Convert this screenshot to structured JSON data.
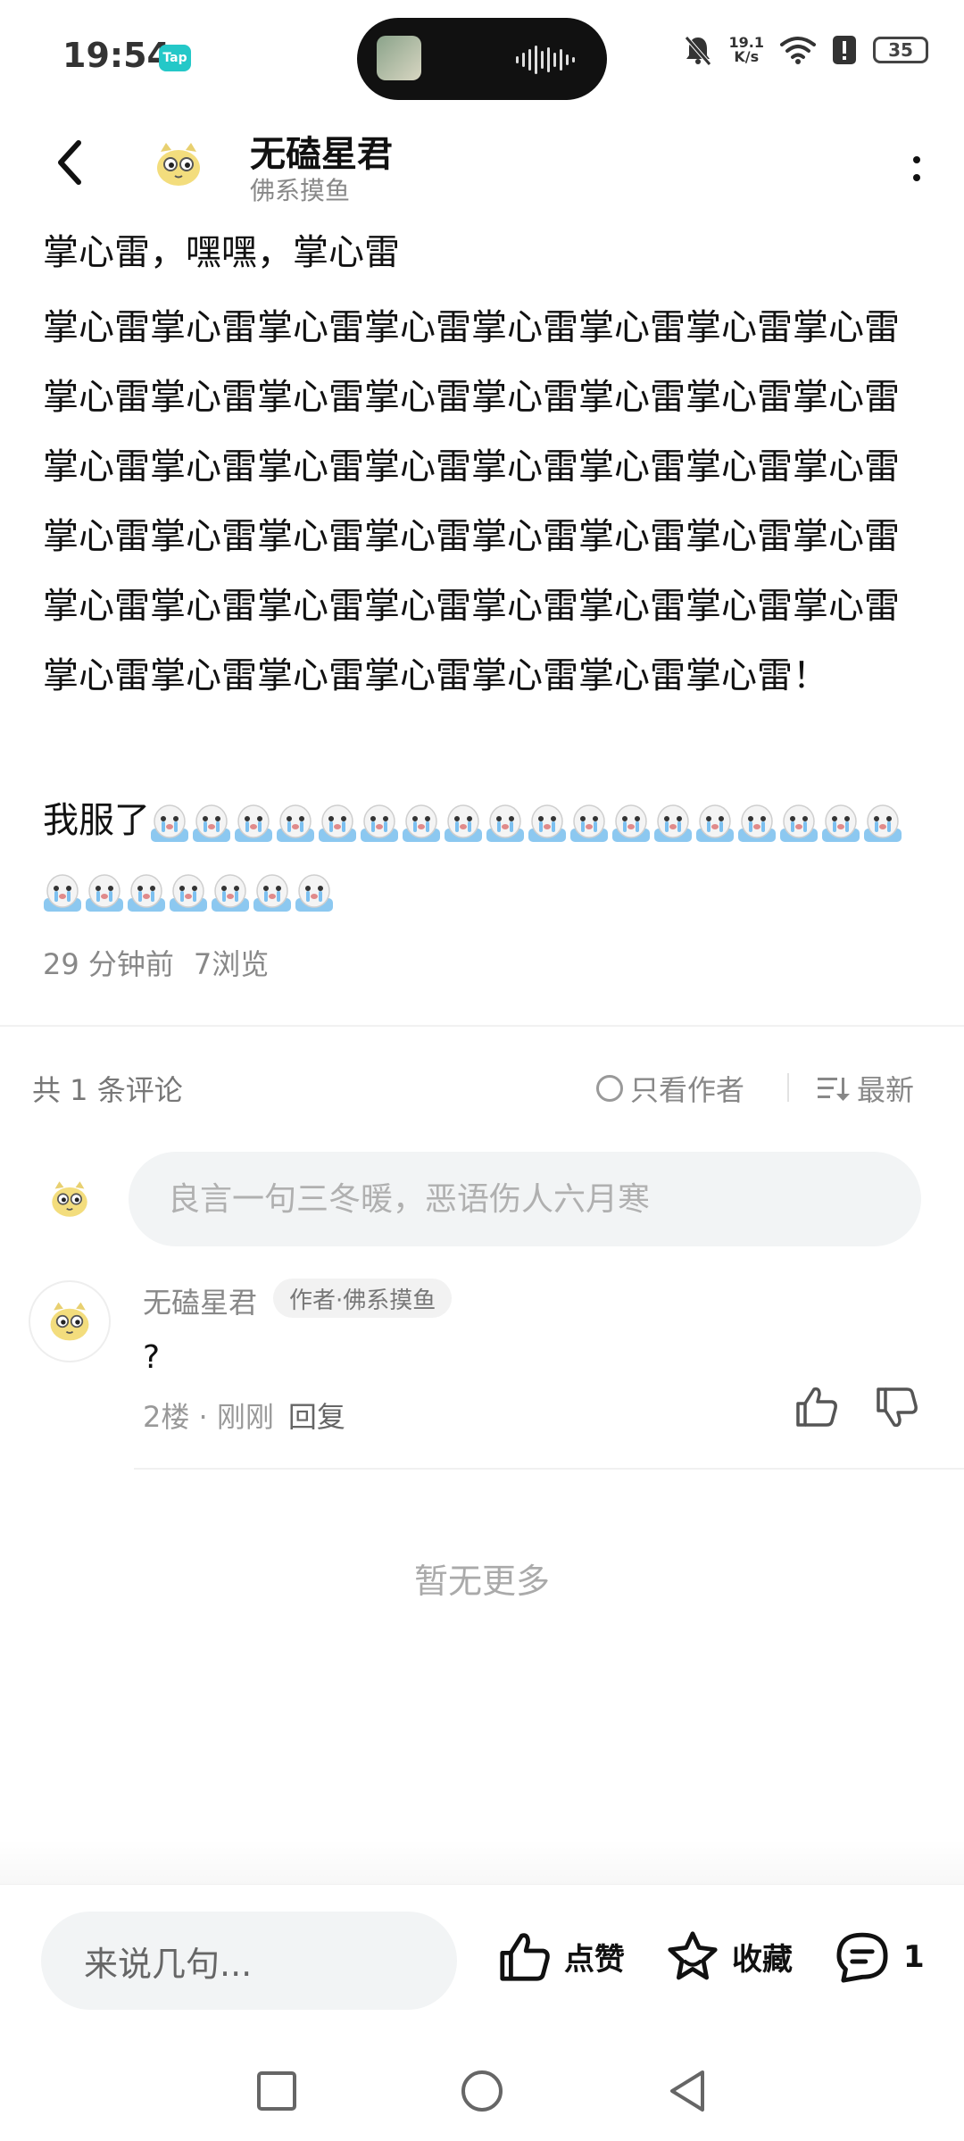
{
  "status_bar": {
    "time": "19:54",
    "app_badge": "Tap",
    "net_speed_value": "19.1",
    "net_speed_unit": "K/s",
    "battery": "35"
  },
  "header": {
    "author_name": "无磕星君",
    "author_group": "佛系摸鱼"
  },
  "post": {
    "title": "掌心雷，嘿嘿，掌心雷",
    "body": "掌心雷掌心雷掌心雷掌心雷掌心雷掌心雷掌心雷掌心雷掌心雷掌心雷掌心雷掌心雷掌心雷掌心雷掌心雷掌心雷掌心雷掌心雷掌心雷掌心雷掌心雷掌心雷掌心雷掌心雷掌心雷掌心雷掌心雷掌心雷掌心雷掌心雷掌心雷掌心雷掌心雷掌心雷掌心雷掌心雷掌心雷掌心雷掌心雷掌心雷掌心雷掌心雷掌心雷掌心雷掌心雷掌心雷掌心雷！",
    "closing_text": "我服了",
    "emoji_name": "crying-seal-emoji",
    "emoji_count": 25,
    "time_ago": "29 分钟前",
    "views": "7浏览"
  },
  "comments_bar": {
    "count_label": "共 1 条评论",
    "only_author_label": "只看作者",
    "sort_label": "最新"
  },
  "comment_input": {
    "placeholder": "良言一句三冬暖，恶语伤人六月寒"
  },
  "comments": [
    {
      "author": "无磕星君",
      "badge": "作者·佛系摸鱼",
      "text": "?",
      "floor": "2楼",
      "time": "刚刚",
      "reply_label": "回复"
    }
  ],
  "no_more_label": "暂无更多",
  "bottom_bar": {
    "input_placeholder": "来说几句...",
    "like_label": "点赞",
    "favorite_label": "收藏",
    "comment_count": "1"
  },
  "colors": {
    "text_primary": "#111111",
    "text_secondary": "#888888",
    "input_bg": "#f2f4f5",
    "tap_badge": "#24c8c8"
  }
}
